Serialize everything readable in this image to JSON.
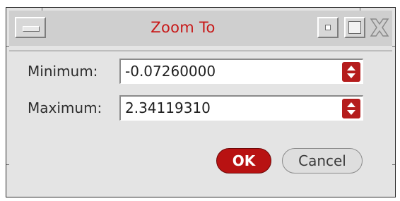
{
  "window": {
    "title": "Zoom To",
    "title_color": "#c81818"
  },
  "titlebar": {
    "menu_icon": "window-menu-icon",
    "minimize_icon": "minimize-icon",
    "maximize_icon": "maximize-icon",
    "close_icon": "close-icon"
  },
  "fields": {
    "minimum": {
      "label": "Minimum:",
      "value": "-0.07260000"
    },
    "maximum": {
      "label": "Maximum:",
      "value": "2.34119310"
    }
  },
  "spinner_icon": "spin-up-down-icon",
  "buttons": {
    "ok_label": "OK",
    "cancel_label": "Cancel"
  },
  "colors": {
    "accent": "#b81212",
    "window_bg": "#e4e4e4"
  }
}
